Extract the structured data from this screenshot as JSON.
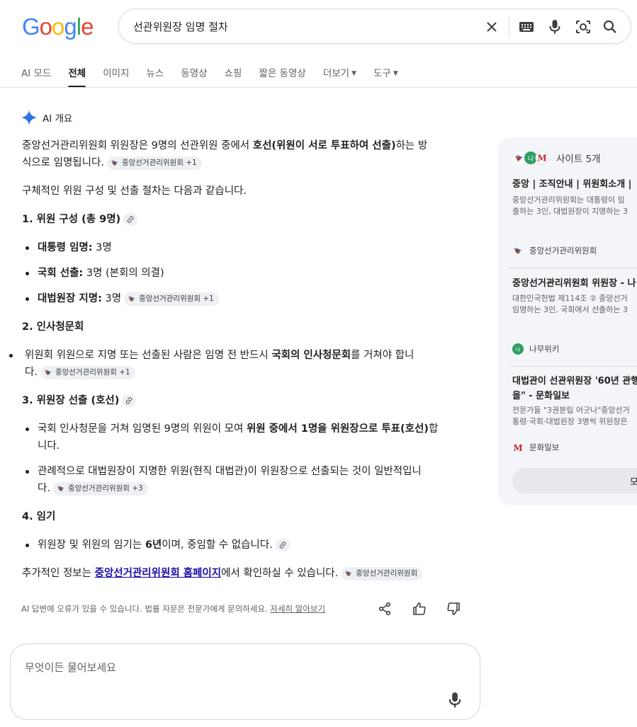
{
  "header": {
    "logo": [
      "G",
      "o",
      "o",
      "g",
      "l",
      "e"
    ],
    "logo_colors": [
      "#4285F4",
      "#EA4335",
      "#FBBC05",
      "#4285F4",
      "#34A853",
      "#EA4335"
    ],
    "query": "선관위원장 임명 절차"
  },
  "tabs": [
    {
      "label": "AI 모드"
    },
    {
      "label": "전체",
      "active": true
    },
    {
      "label": "이미지"
    },
    {
      "label": "뉴스"
    },
    {
      "label": "동영상"
    },
    {
      "label": "쇼핑"
    },
    {
      "label": "짧은 동영상"
    },
    {
      "label": "더보기",
      "dropdown": true
    },
    {
      "label": "도구",
      "dropdown": true
    }
  ],
  "ai_overview": {
    "heading": "AI 개요",
    "intro_pre": "중앙선거관리위원회 위원장은 9명의 선관위원 중에서 ",
    "intro_bold": "호선(위원이 서로 투표하여 선출)",
    "intro_post1": "하는 방",
    "intro_post2": "식으로 임명됩니다.",
    "intro_chip": "중앙선거관리위원회 +1",
    "lead": "구체적인 위원 구성 및 선출 절차는 다음과 같습니다.",
    "s1_title": "1. 위원 구성 (총 9명)",
    "s1_items": [
      {
        "bold": "대통령 임명:",
        "text": " 3명"
      },
      {
        "bold": "국회 선출:",
        "text": " 3명 (본회의 의결)"
      },
      {
        "bold": "대법원장 지명:",
        "text": " 3명",
        "chip": "중앙선거관리위원회 +1"
      }
    ],
    "s2_title": "2. 인사청문회",
    "s2_pre": "위원회 위원으로 지명 또는 선출된 사람은 임명 전 반드시 ",
    "s2_bold": "국회의 인사청문회",
    "s2_post": "를 거쳐야 합니",
    "s2_line2": "다.",
    "s2_chip": "중앙선거관리위원회 +1",
    "s3_title": "3. 위원장 선출 (호선)",
    "s3_i1_pre": "국회 인사청문을 거쳐 임명된 9명의 위원이 모여 ",
    "s3_i1_bold": "위원 중에서 1명을 위원장으로 투표(호선)",
    "s3_i1_post": "합",
    "s3_i1_line2": "니다.",
    "s3_i2_line1": "관례적으로 대법원장이 지명한 위원(현직 대법관)이 위원장으로 선출되는 것이 일반적입니",
    "s3_i2_line2": "다.",
    "s3_i2_chip": "중앙선거관리위원회 +3",
    "s4_title": "4. 임기",
    "s4_pre": "위원장 및 위원의 임기는 ",
    "s4_bold": "6년",
    "s4_post": "이며, 중임할 수 없습니다.",
    "more_pre": "추가적인 정보는 ",
    "more_link": "중앙선거관리위원회 홈페이지",
    "more_post": "에서 확인하실 수 있습니다.",
    "more_chip": "중앙선거관리위원회"
  },
  "footer": {
    "disclaimer": "AI 답변에 오류가 있을 수 있습니다. 법률 자문은 전문가에게 문의하세요.",
    "learn_more": "자세히 알아보기"
  },
  "ask": {
    "placeholder": "무엇이든 물어보세요"
  },
  "sources_panel": {
    "heading": "사이트 5개",
    "items": [
      {
        "title": "중앙 | 조직안내 | 위원회소개 |",
        "snippet1": "중앙선거관리위원회는 대통령이 임",
        "snippet2": "출하는 3인, 대법원장이 지명하는 3",
        "source": "중앙선거관리위원회"
      },
      {
        "title": "중앙선거관리위원회 위원장 - 나",
        "snippet1": "대한민국헌법 제114조 ② 중앙선거",
        "snippet2": "임명하는 3인, 국회에서 선출하는 3",
        "source": "나무위키"
      },
      {
        "title1": "대법관이 선관위원장 '60년 관행",
        "title2": "을\" - 문화일보",
        "snippet1": "전문가들 \"3권분립 어긋나\"중앙선거",
        "snippet2": "통령·국회·대법원장 3명씩 위원장은",
        "source": "문화일보"
      }
    ],
    "button": "모"
  }
}
